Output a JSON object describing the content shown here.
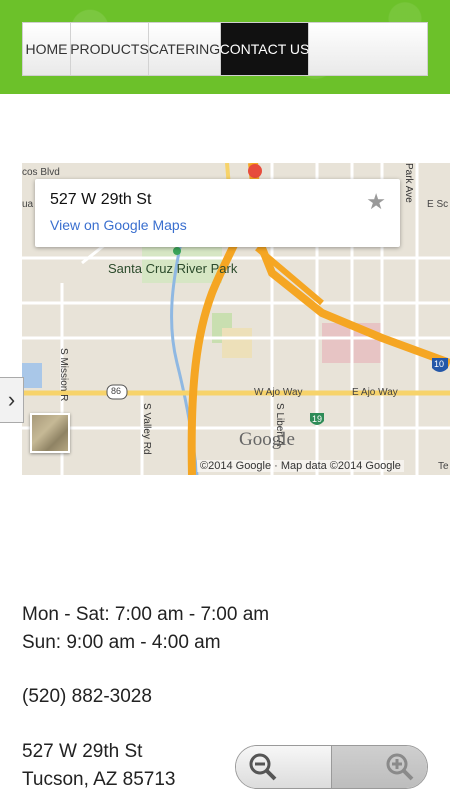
{
  "nav": {
    "items": [
      {
        "label": "HOME"
      },
      {
        "label": "PRODUCTS"
      },
      {
        "label": "CATERING"
      },
      {
        "label": "CONTACT US"
      }
    ]
  },
  "map": {
    "info_address": "527 W 29th St",
    "info_link": "View on Google Maps",
    "labels": {
      "park": "Santa Cruz River Park",
      "w_ajo": "W Ajo Way",
      "e_ajo": "E Ajo Way",
      "cos_blvd": "cos Blvd",
      "park_ave": "Park Ave",
      "e_sc": "E Sc",
      "mission": "S Mission R",
      "valley": "S Valley Rd",
      "liberty": "S Libert A",
      "route86": "86",
      "route19": "19",
      "route10": "10",
      "ua": "ua",
      "te": "Te"
    },
    "copyright": "©2014 Google · Map data ©2014 Google",
    "google_logo": "Google"
  },
  "contact": {
    "hours_weekday": "Mon - Sat: 7:00 am - 7:00 am",
    "hours_sunday": "Sun: 9:00 am - 4:00 am",
    "phone": "(520) 882-3028",
    "address_line1": "527 W 29th St",
    "address_line2": "Tucson, AZ 85713"
  },
  "colors": {
    "header_green": "#6cc12a",
    "nav_active": "#111111",
    "highway": "#f5a623",
    "link_blue": "#3a6fcf"
  },
  "icons": {
    "star": "star-icon",
    "pin": "map-pin-icon",
    "arrow": "chevron-right-icon",
    "zoom_out": "zoom-out-icon",
    "zoom_in": "zoom-in-icon"
  }
}
